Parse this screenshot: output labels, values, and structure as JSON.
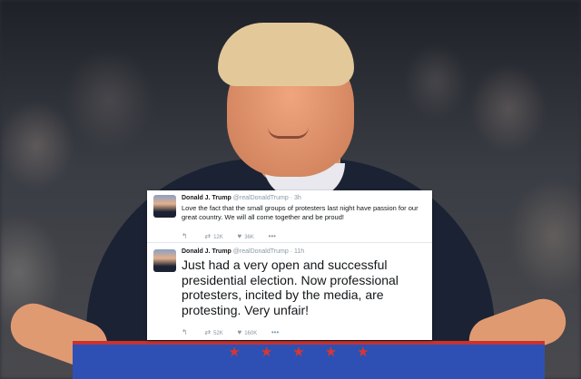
{
  "tweets": [
    {
      "name": "Donald J. Trump",
      "handle": "@realDonaldTrump",
      "time": "· 3h",
      "text": "Love the fact that the small groups of protesters last night have passion for our great country. We will all come together and be proud!",
      "retweets": "12K",
      "likes": "36K"
    },
    {
      "name": "Donald J. Trump",
      "handle": "@realDonaldTrump",
      "time": "· 11h",
      "text": "Just had a very open and successful presidential election. Now professional protesters, incited by the media, are protesting. Very unfair!",
      "retweets": "52K",
      "likes": "160K"
    }
  ],
  "icons": [
    "reply-icon",
    "retweet-icon",
    "like-icon",
    "more-icon"
  ],
  "colors": {
    "podium": "#2e50b5",
    "podium_trim": "#c8332f",
    "suit": "#1b2233"
  }
}
